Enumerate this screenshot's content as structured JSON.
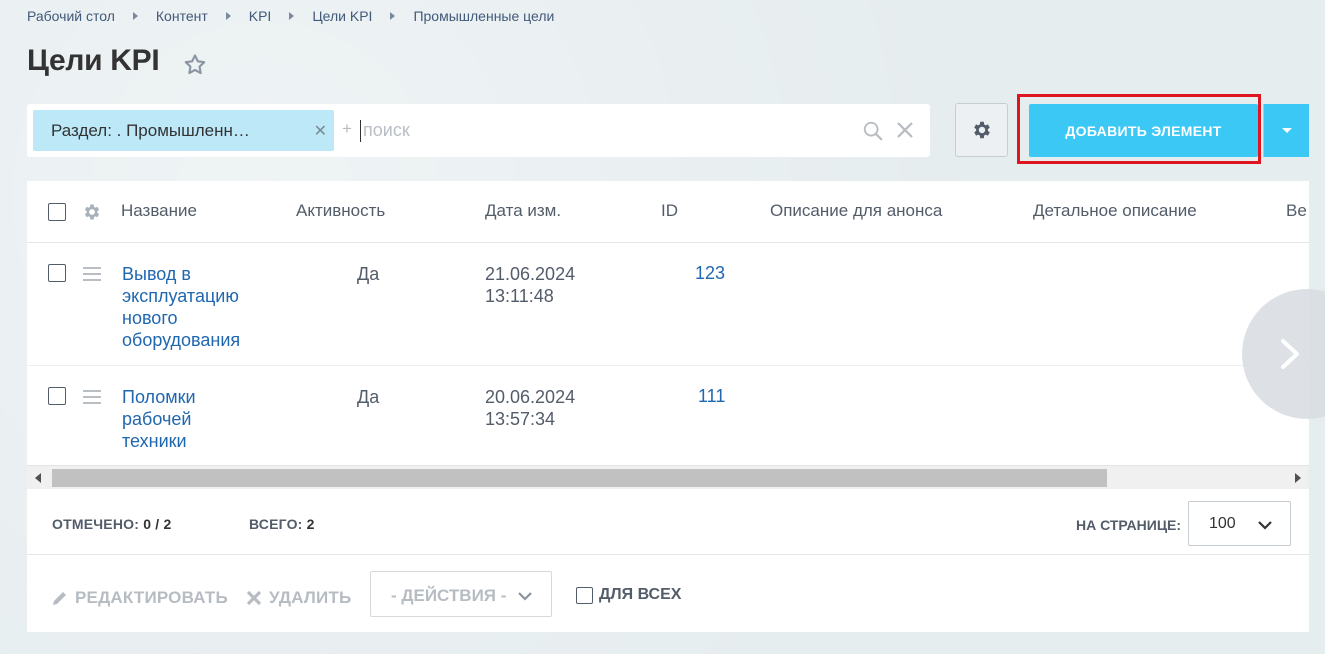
{
  "breadcrumb": [
    "Рабочий стол",
    "Контент",
    "KPI",
    "Цели KPI",
    "Промышленные цели"
  ],
  "page_title": "Цели KPI",
  "filter": {
    "chip_label": "Раздел: . Промышленн…",
    "plus": "+",
    "placeholder": "поиск"
  },
  "toolbar": {
    "add_label": "ДОБАВИТЬ ЭЛЕМЕНТ"
  },
  "grid": {
    "columns": [
      "Название",
      "Активность",
      "Дата изм.",
      "ID",
      "Описание для анонса",
      "Детальное описание",
      "Ве"
    ],
    "rows": [
      {
        "name": "Вывод в эксплуатацию нового оборудования",
        "active": "Да",
        "date": "21.06.2024",
        "time": "13:11:48",
        "id": "123"
      },
      {
        "name": "Поломки рабочей техники",
        "active": "Да",
        "date": "20.06.2024",
        "time": "13:57:34",
        "id": "111"
      }
    ]
  },
  "footer": {
    "selected_label": "ОТМЕЧЕНО:",
    "selected_value": "0 / 2",
    "total_label": "ВСЕГО:",
    "total_value": "2",
    "per_page_label": "НА СТРАНИЦЕ:",
    "per_page_value": "100"
  },
  "actions": {
    "edit_label": "РЕДАКТИРОВАТЬ",
    "delete_label": "УДАЛИТЬ",
    "actions_select": "- ДЕЙСТВИЯ -",
    "for_all_label": "ДЛЯ ВСЕХ"
  },
  "colors": {
    "accent": "#3bc8f5",
    "link": "#2067b0",
    "highlight_border": "#e0141e",
    "chip_bg": "#bce8f8"
  }
}
